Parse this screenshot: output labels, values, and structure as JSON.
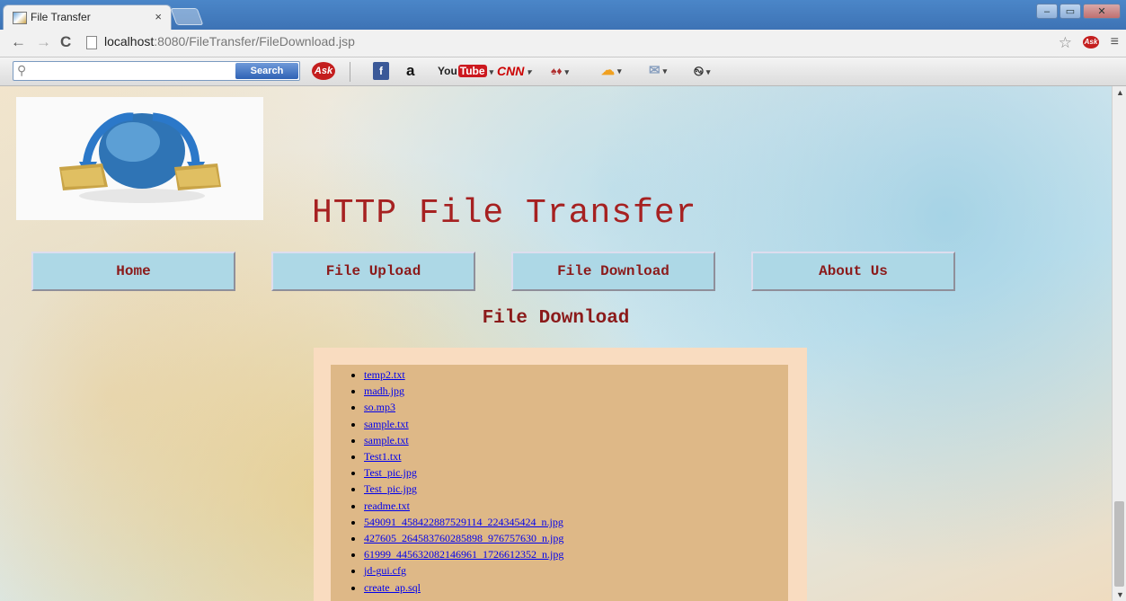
{
  "browser": {
    "tab_title": "File Transfer",
    "tab_close": "×",
    "url_host": "localhost",
    "url_path": ":8080/FileTransfer/FileDownload.jsp"
  },
  "ask_toolbar": {
    "search_placeholder": "",
    "search_button": "Search",
    "ask_label": "Ask",
    "facebook_label": "f",
    "amazon_label": "a",
    "youtube_label": "You",
    "youtube_tube": "Tube",
    "cnn_label": "CNN"
  },
  "page": {
    "site_title": "HTTP File Transfer",
    "nav": [
      {
        "label": "Home"
      },
      {
        "label": "File Upload"
      },
      {
        "label": "File Download"
      },
      {
        "label": "About Us"
      }
    ],
    "section_title": "File Download",
    "files": [
      "temp2.txt",
      "madh.jpg",
      "so.mp3",
      "sample.txt",
      "sample.txt",
      "Test1.txt",
      "Test_pic.jpg",
      "Test_pic.jpg",
      "readme.txt",
      "549091_458422887529114_224345424_n.jpg",
      "427605_264583760285898_976757630_n.jpg",
      "61999_445632082146961_1726612352_n.jpg",
      "jd-gui.cfg",
      "create_ap.sql"
    ]
  },
  "colors": {
    "title_red": "#a62121",
    "nav_bg": "#add8e6",
    "panel_outer": "#f9dcc0",
    "panel_inner": "#deb887"
  }
}
